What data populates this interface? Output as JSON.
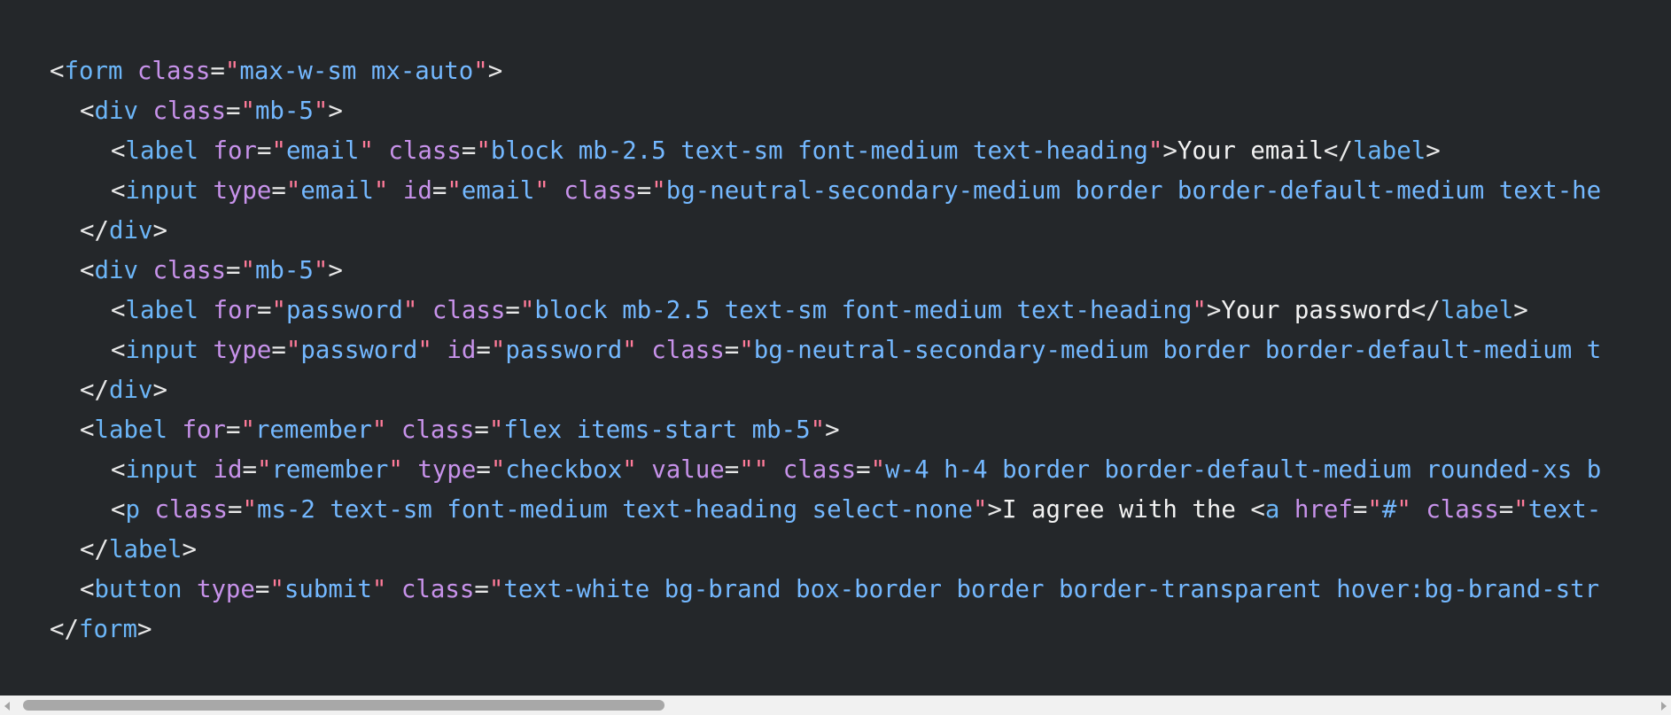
{
  "code": {
    "form_tag": "form",
    "div_tag": "div",
    "label_tag": "label",
    "input_tag": "input",
    "p_tag": "p",
    "a_tag": "a",
    "button_tag": "button",
    "attr_class": "class",
    "attr_for": "for",
    "attr_type": "type",
    "attr_id": "id",
    "attr_value": "value",
    "attr_href": "href",
    "form_class": "max-w-sm mx-auto",
    "div_class": "mb-5",
    "label_class": "block mb-2.5 text-sm font-medium text-heading",
    "email_for": "email",
    "email_label_text": "Your email",
    "email_type": "email",
    "email_id": "email",
    "email_input_class_visible": "bg-neutral-secondary-medium border border-default-medium text-he",
    "password_for": "password",
    "password_label_text": "Your password",
    "password_type": "password",
    "password_id": "password",
    "password_input_class_visible": "bg-neutral-secondary-medium border border-default-medium t",
    "remember_for": "remember",
    "remember_label_class": "flex items-start mb-5",
    "remember_id": "remember",
    "checkbox_type": "checkbox",
    "checkbox_value": "",
    "checkbox_class_visible": "w-4 h-4 border border-default-medium rounded-xs b",
    "p_class": "ms-2 text-sm font-medium text-heading select-none",
    "p_text": "I agree with the ",
    "a_href": "#",
    "a_class_visible": "text-",
    "submit_type": "submit",
    "button_class_visible": "text-white bg-brand box-border border border-transparent hover:bg-brand-str"
  },
  "colors": {
    "background": "#24272a",
    "tag": "#6cb6f8",
    "attribute": "#c792ea",
    "quote": "#ff7b9a",
    "value": "#74b8ff",
    "text": "#f2f2f2",
    "scrollbar_track": "#f1f1f1",
    "scrollbar_thumb": "#a8a8a8"
  }
}
